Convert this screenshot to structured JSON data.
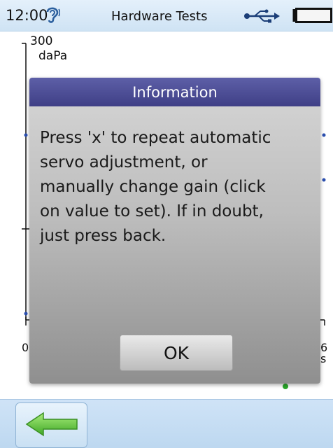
{
  "status_bar": {
    "time": "12:00",
    "title": "Hardware Tests",
    "icons": [
      "ear-icon",
      "usb-icon",
      "battery-icon"
    ]
  },
  "chart": {
    "y_top_label": "300",
    "y_unit": "daPa",
    "x_start_label": "0",
    "x_end_label": "6",
    "x_unit": "s"
  },
  "dialog": {
    "title": "Information",
    "message": "Press 'x' to repeat automatic\nservo adjustment, or\nmanually change gain (click\non value to set). If in doubt,\njust press back.",
    "ok_label": "OK"
  },
  "bottom_bar": {
    "back_icon": "back-arrow-icon"
  },
  "colors": {
    "dialog_header": "#4b4b8f",
    "status_bar": "#d9eaf8",
    "series_point": "#2b4fb0",
    "marker_green": "#2aa82a",
    "arrow_green": "#5bc23a"
  }
}
